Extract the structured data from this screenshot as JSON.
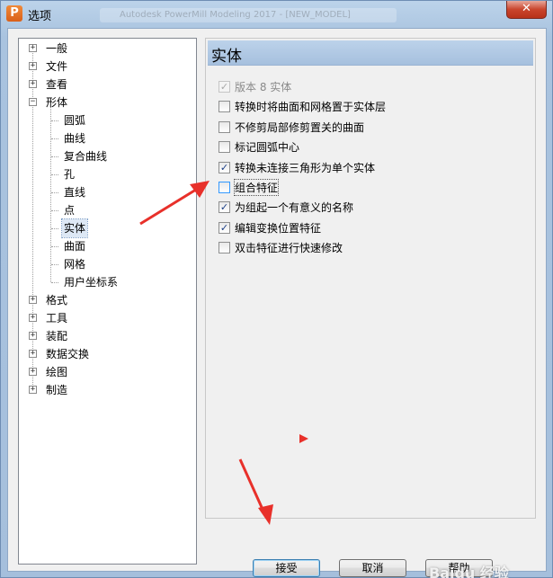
{
  "window": {
    "title": "选项",
    "app_icon_letter": "P",
    "background_title": "Autodesk PowerMill Modeling 2017 - [NEW_MODEL]",
    "close_label": "✕"
  },
  "tree": {
    "items": [
      {
        "label": "一般",
        "level": 0,
        "expander": "+"
      },
      {
        "label": "文件",
        "level": 0,
        "expander": "+"
      },
      {
        "label": "查看",
        "level": 0,
        "expander": "+"
      },
      {
        "label": "形体",
        "level": 0,
        "expander": "−"
      },
      {
        "label": "圆弧",
        "level": 1
      },
      {
        "label": "曲线",
        "level": 1
      },
      {
        "label": "复合曲线",
        "level": 1
      },
      {
        "label": "孔",
        "level": 1
      },
      {
        "label": "直线",
        "level": 1
      },
      {
        "label": "点",
        "level": 1
      },
      {
        "label": "实体",
        "level": 1,
        "selected": true
      },
      {
        "label": "曲面",
        "level": 1
      },
      {
        "label": "网格",
        "level": 1
      },
      {
        "label": "用户坐标系",
        "level": 1
      },
      {
        "label": "格式",
        "level": 0,
        "expander": "+"
      },
      {
        "label": "工具",
        "level": 0,
        "expander": "+"
      },
      {
        "label": "装配",
        "level": 0,
        "expander": "+"
      },
      {
        "label": "数据交换",
        "level": 0,
        "expander": "+"
      },
      {
        "label": "绘图",
        "level": 0,
        "expander": "+"
      },
      {
        "label": "制造",
        "level": 0,
        "expander": "+"
      }
    ]
  },
  "panel": {
    "title": "实体",
    "options": [
      {
        "label": "版本 8 实体",
        "checked": true,
        "disabled": true
      },
      {
        "label": "转换时将曲面和网格置于实体层",
        "checked": false
      },
      {
        "label": "不修剪局部修剪置关的曲面",
        "checked": false
      },
      {
        "label": "标记圆弧中心",
        "checked": false
      },
      {
        "label": "转换未连接三角形为单个实体",
        "checked": true
      },
      {
        "label": "组合特征",
        "checked": false,
        "focused": true
      },
      {
        "label": "为组起一个有意义的名称",
        "checked": true
      },
      {
        "label": "编辑变换位置特征",
        "checked": true
      },
      {
        "label": "双击特征进行快速修改",
        "checked": false
      }
    ]
  },
  "buttons": {
    "accept": "接受",
    "cancel": "取消",
    "help": "帮助"
  },
  "watermark": "Baidu 经验",
  "colors": {
    "annotation_arrow": "#e8302a",
    "selection": "#dde8f5",
    "title_bar": "#a9c3df"
  }
}
